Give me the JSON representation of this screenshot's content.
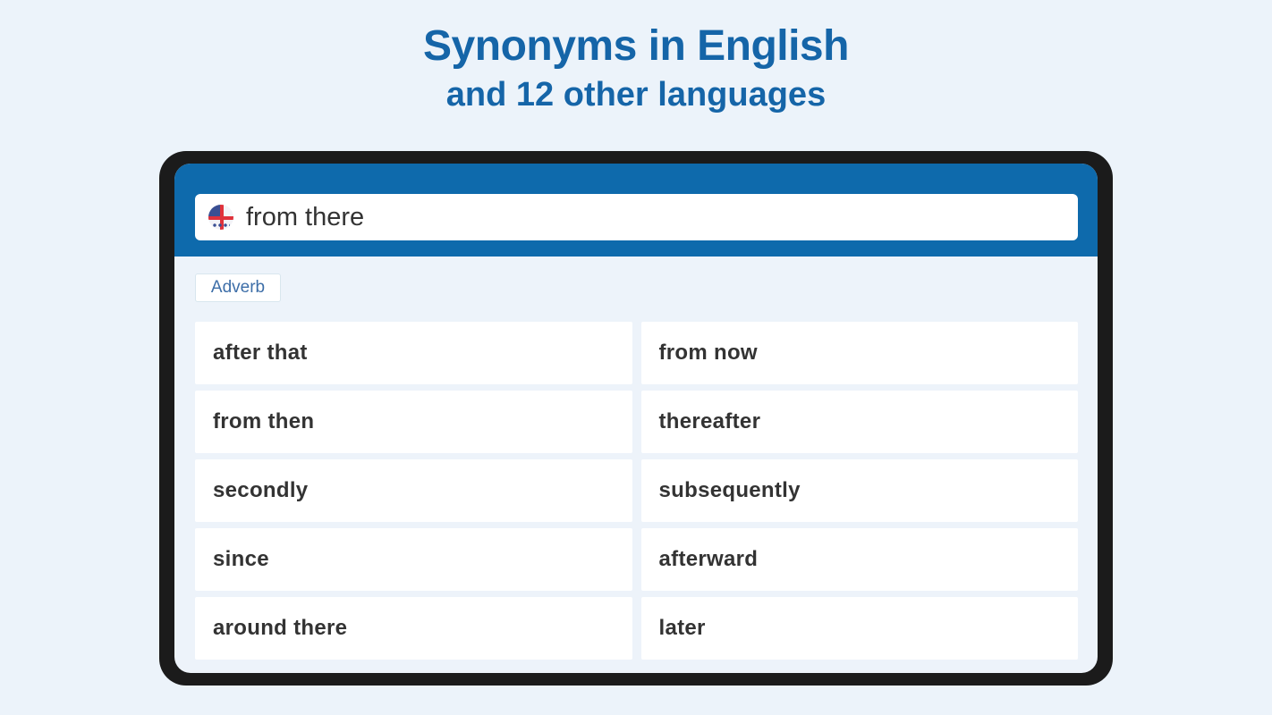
{
  "headline": {
    "title": "Synonyms in English",
    "subtitle": "and 12 other languages"
  },
  "app": {
    "search": {
      "language_icon": "uk-flag-icon",
      "value": "from there"
    },
    "part_of_speech": "Adverb",
    "synonyms": [
      "after that",
      "from now",
      "from then",
      "thereafter",
      "secondly",
      "subsequently",
      "since",
      "afterward",
      "around there",
      "later"
    ]
  },
  "colors": {
    "brand_blue": "#0e6aac",
    "headline_blue": "#1565a8",
    "background": "#ecf3fa",
    "device_frame": "#1b1b1b"
  }
}
